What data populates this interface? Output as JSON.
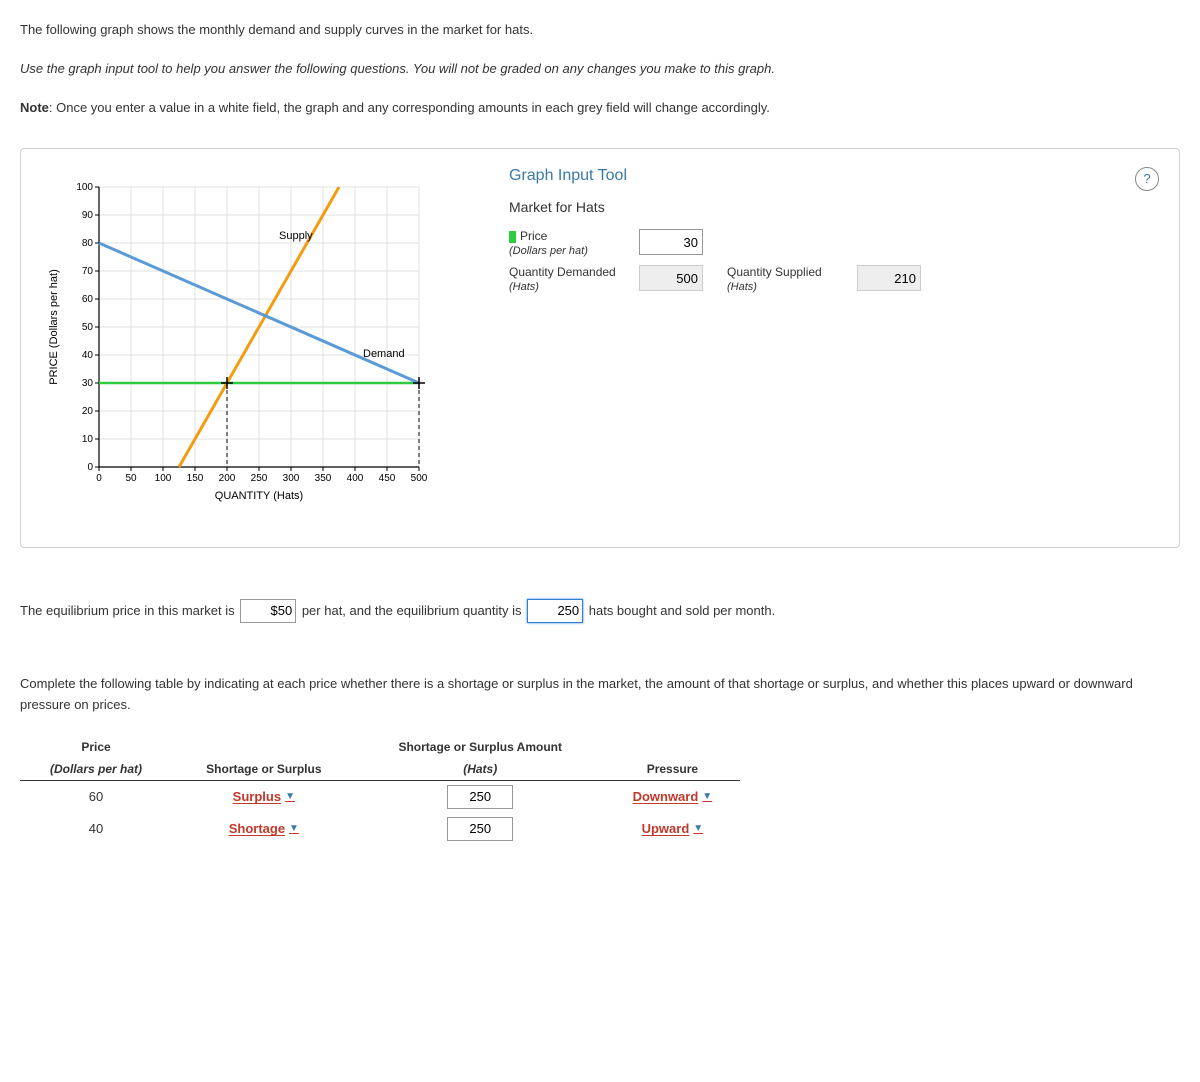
{
  "intro": {
    "p1": "The following graph shows the monthly demand and supply curves in the market for hats.",
    "p2": "Use the graph input tool to help you answer the following questions. You will not be graded on any changes you make to this graph.",
    "note_label": "Note",
    "note_text": ": Once you enter a value in a white field, the graph and any corresponding amounts in each grey field will change accordingly."
  },
  "tool": {
    "title": "Graph Input Tool",
    "subtitle": "Market for Hats",
    "price_label": "Price",
    "price_unit": "(Dollars per hat)",
    "price_value": "30",
    "qd_label": "Quantity Demanded",
    "qd_unit": "(Hats)",
    "qd_value": "500",
    "qs_label": "Quantity Supplied",
    "qs_unit": "(Hats)",
    "qs_value": "210"
  },
  "chart_data": {
    "type": "line",
    "title": "",
    "xlabel": "QUANTITY (Hats)",
    "ylabel": "PRICE (Dollars per hat)",
    "xlim": [
      0,
      500
    ],
    "ylim": [
      0,
      100
    ],
    "xticks": [
      0,
      50,
      100,
      150,
      200,
      250,
      300,
      350,
      400,
      450,
      500
    ],
    "yticks": [
      0,
      10,
      20,
      30,
      40,
      50,
      60,
      70,
      80,
      90,
      100
    ],
    "series": [
      {
        "name": "Supply",
        "color": "#f39c12",
        "points": [
          [
            125,
            0
          ],
          [
            375,
            100
          ]
        ]
      },
      {
        "name": "Demand",
        "color": "#5b9bd5",
        "points": [
          [
            0,
            80
          ],
          [
            500,
            30
          ]
        ]
      },
      {
        "name": "PriceLine",
        "color": "#2ecc40",
        "points": [
          [
            0,
            30
          ],
          [
            500,
            30
          ]
        ]
      }
    ],
    "labels": [
      {
        "text": "Supply",
        "x": 270,
        "y": 80
      },
      {
        "text": "Demand",
        "x": 420,
        "y": 40
      }
    ],
    "markers": [
      {
        "type": "cross",
        "x": 200,
        "y": 30
      },
      {
        "type": "cross",
        "x": 500,
        "y": 30
      }
    ]
  },
  "eq": {
    "pre": "The equilibrium price in this market is",
    "price_value": "$50",
    "mid": " per hat, and the equilibrium quantity is ",
    "qty_value": "250",
    "post": " hats bought and sold per month."
  },
  "table_instr": "Complete the following table by indicating at each price whether there is a shortage or surplus in the market, the amount of that shortage or surplus, and whether this places upward or downward pressure on prices.",
  "table": {
    "h_price": "Price",
    "h_price_unit": "(Dollars per hat)",
    "h_ss": "Shortage or Surplus",
    "h_amt": "Shortage or Surplus Amount",
    "h_amt_unit": "(Hats)",
    "h_pressure": "Pressure",
    "rows": [
      {
        "price": "60",
        "ss": "Surplus",
        "amt": "250",
        "pressure": "Downward"
      },
      {
        "price": "40",
        "ss": "Shortage",
        "amt": "250",
        "pressure": "Upward"
      }
    ]
  }
}
